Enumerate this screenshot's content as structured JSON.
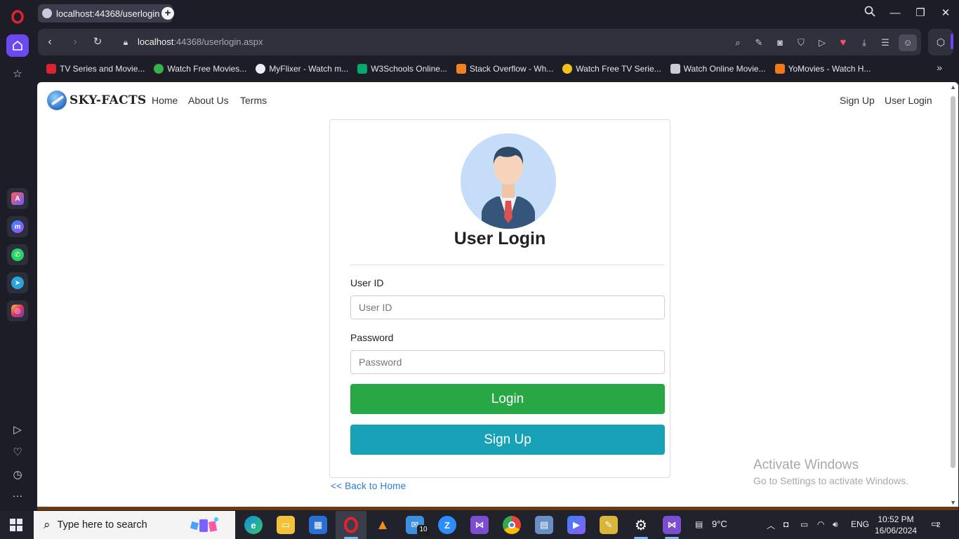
{
  "browser": {
    "tab_title": "localhost:44368/userlogin",
    "url_host": "localhost",
    "url_rest": ":44368/userlogin.aspx",
    "bookmarks": [
      {
        "label": "TV Series and Movie...",
        "color": "#d8242f"
      },
      {
        "label": "Watch Free Movies...",
        "color": "#36b24a"
      },
      {
        "label": "MyFlixer - Watch m...",
        "color": "#e9eef6"
      },
      {
        "label": "W3Schools Online...",
        "color": "#04aa6d"
      },
      {
        "label": "Stack Overflow - Wh...",
        "color": "#f48024"
      },
      {
        "label": "Watch Free TV Serie...",
        "color": "#f2c21b"
      },
      {
        "label": "Watch Online Movie...",
        "color": "#c9ccd4"
      },
      {
        "label": "YoMovies - Watch H...",
        "color": "#f07a1a"
      }
    ]
  },
  "site": {
    "brand": "SKY-FACTS",
    "nav_left": [
      "Home",
      "About Us",
      "Terms"
    ],
    "nav_right": [
      "Sign Up",
      "User Login"
    ]
  },
  "login": {
    "title": "User Login",
    "user_label": "User ID",
    "user_placeholder": "User ID",
    "password_label": "Password",
    "password_placeholder": "Password",
    "login_button": "Login",
    "signup_button": "Sign Up",
    "back_link": "<< Back to Home",
    "login_color": "#28a745",
    "signup_color": "#17a2b8"
  },
  "watermark": {
    "title": "Activate Windows",
    "subtitle": "Go to Settings to activate Windows."
  },
  "taskbar": {
    "search_text": "Type here to search",
    "weather": "9°C",
    "language": "ENG",
    "time": "10:52 PM",
    "date": "16/06/2024",
    "notification_count": "2",
    "mail_badge": "10"
  }
}
